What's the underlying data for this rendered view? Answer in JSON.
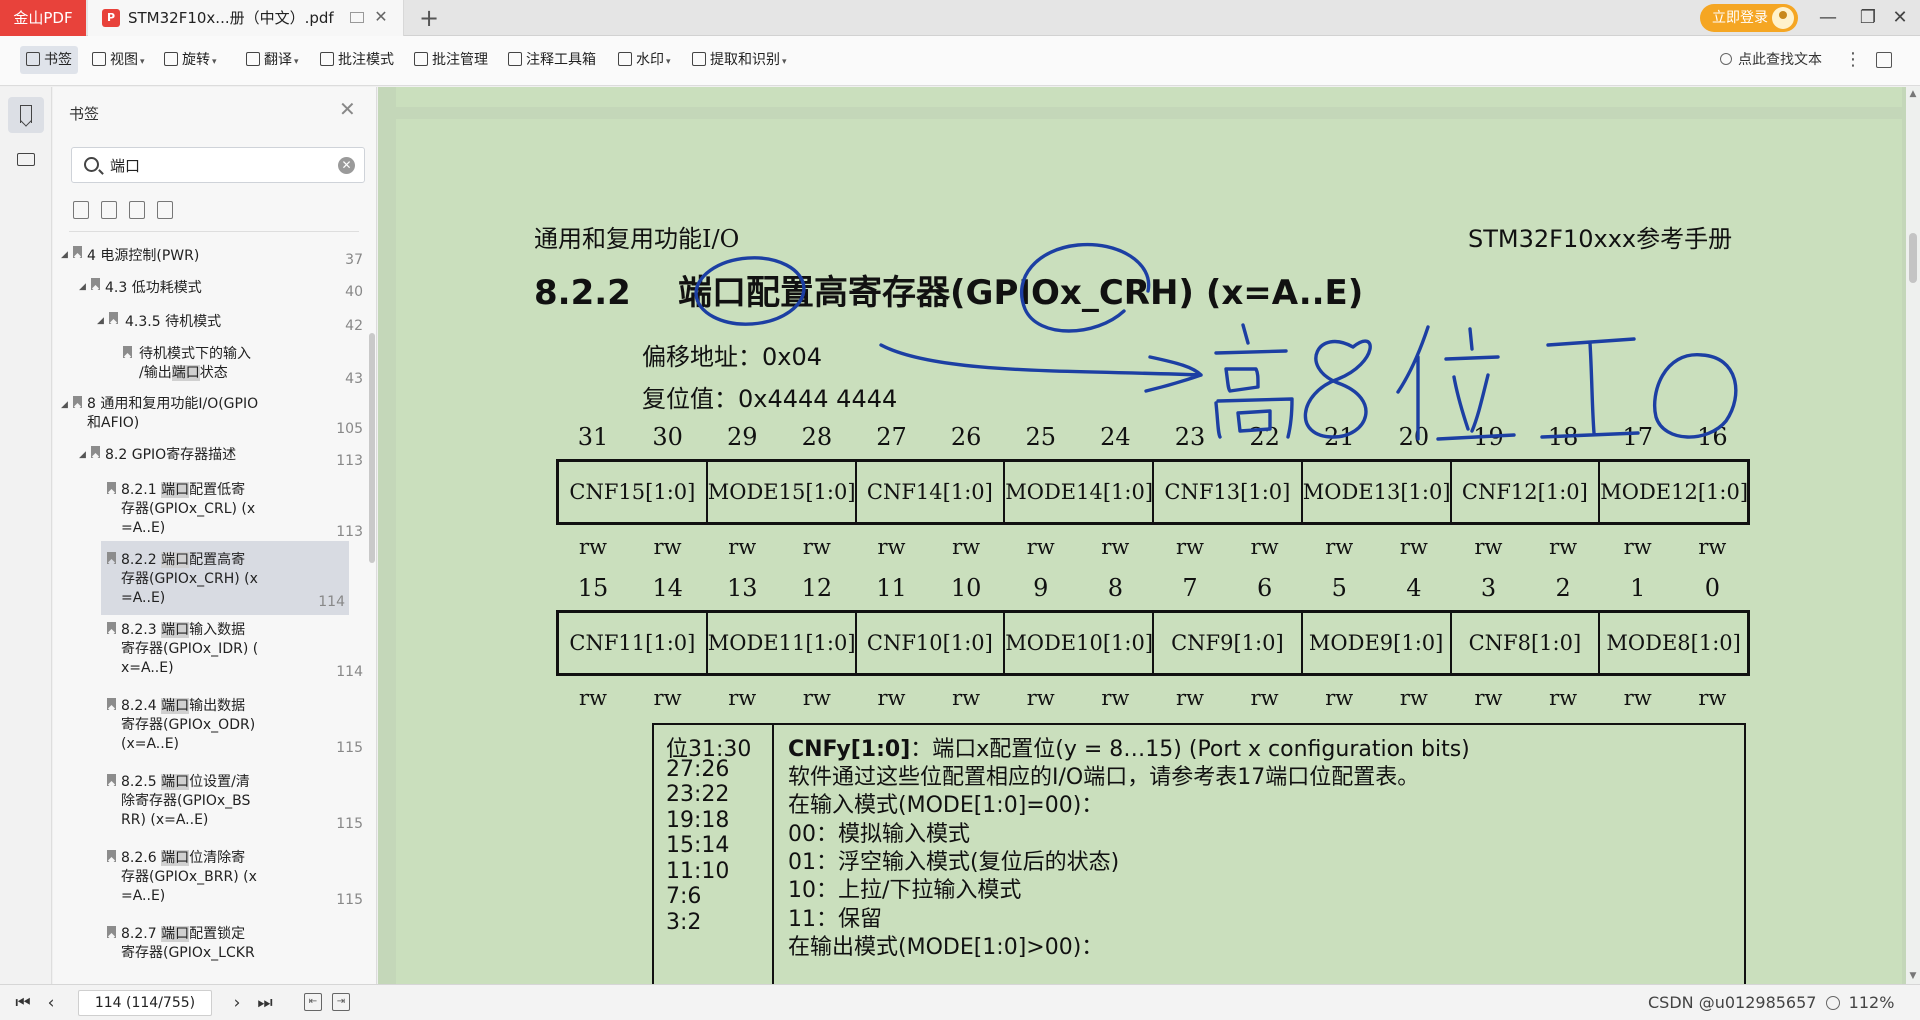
{
  "titlebar": {
    "app_name": "金山PDF",
    "doc_tab_title": "STM32F10x...册（中文）.pdf",
    "new_tab": "+",
    "login_label": "立即登录",
    "minimize": "—",
    "restore": "❐",
    "close": "✕",
    "accent_color": "#e8423b",
    "login_color": "#f5a623"
  },
  "toolbar": {
    "bookmark": "书签",
    "view": "视图",
    "rotate": "旋转",
    "translate": "翻译",
    "annotate_mode": "批注模式",
    "annotate_manage": "批注管理",
    "annotate_toolbox": "注释工具箱",
    "watermark": "水印",
    "extract_ocr": "提取和识别",
    "search_doc": "点此查找文本"
  },
  "sidebar": {
    "title": "书签",
    "search_value": "端口",
    "items": [
      {
        "caret": "◢",
        "text": "4 电源控制(PWR)",
        "page": "37"
      },
      {
        "caret": "◢",
        "text": "4.3 低功耗模式",
        "page": "40"
      },
      {
        "caret": "◢",
        "text": "4.3.5 待机模式",
        "page": "42"
      },
      {
        "line1": "待机模式下的输入",
        "line2_pre": "/输出",
        "line2_hl": "端口",
        "line2_post": "状态",
        "page": "43"
      },
      {
        "caret": "◢",
        "line1": "8 通用和复用功能I/O(GPIO",
        "line2": "和AFIO)",
        "page": "105"
      },
      {
        "caret": "◢",
        "text": "8.2 GPIO寄存器描述",
        "page": "113"
      },
      {
        "pre": "8.2.1 ",
        "hl": "端口",
        "post": "配置低寄",
        "line2": "存器(GPIOx_CRL) (x",
        "line3": "=A..E)",
        "page": "113"
      },
      {
        "pre": "8.2.2 ",
        "hl": "端口",
        "post": "配置高寄",
        "line2": "存器(GPIOx_CRH) (x",
        "line3": "=A..E)",
        "page": "114"
      },
      {
        "pre": "8.2.3 ",
        "hl": "端口",
        "post": "输入数据",
        "line2": "寄存器(GPIOx_IDR) (",
        "line3": "x=A..E)",
        "page": "114"
      },
      {
        "pre": "8.2.4 ",
        "hl": "端口",
        "post": "输出数据",
        "line2": "寄存器(GPIOx_ODR)",
        "line3": "(x=A..E)",
        "page": "115"
      },
      {
        "pre": "8.2.5 ",
        "hl": "端口",
        "post": "位设置/清",
        "line2": "除寄存器(GPIOx_BS",
        "line3": "RR) (x=A..E)",
        "page": "115"
      },
      {
        "pre": "8.2.6 ",
        "hl": "端口",
        "post": "位清除寄",
        "line2": "存器(GPIOx_BRR) (x",
        "line3": "=A..E)",
        "page": "115"
      },
      {
        "pre": "8.2.7 ",
        "hl": "端口",
        "post": "配置锁定",
        "line2": "寄存器(GPIOx_LCKR"
      }
    ]
  },
  "document": {
    "header_left": "通用和复用功能I/O",
    "header_right": "STM32F10xxx参考手册",
    "section_number": "8.2.2",
    "section_title": "端口配置高寄存器(GPIOx_CRH) (x=A..E)",
    "offset_line": "偏移地址：0x04",
    "reset_line": "复位值：0x4444 4444",
    "bits_high": [
      "31",
      "30",
      "29",
      "28",
      "27",
      "26",
      "25",
      "24",
      "23",
      "22",
      "21",
      "20",
      "19",
      "18",
      "17",
      "16"
    ],
    "fields_high": [
      "CNF15[1:0]",
      "MODE15[1:0]",
      "CNF14[1:0]",
      "MODE14[1:0]",
      "CNF13[1:0]",
      "MODE13[1:0]",
      "CNF12[1:0]",
      "MODE12[1:0]"
    ],
    "bits_low": [
      "15",
      "14",
      "13",
      "12",
      "11",
      "10",
      "9",
      "8",
      "7",
      "6",
      "5",
      "4",
      "3",
      "2",
      "1",
      "0"
    ],
    "fields_low": [
      "CNF11[1:0]",
      "MODE11[1:0]",
      "CNF10[1:0]",
      "MODE10[1:0]",
      "CNF9[1:0]",
      "MODE9[1:0]",
      "CNF8[1:0]",
      "MODE8[1:0]"
    ],
    "access": "rw",
    "desc_bits": [
      "位31:30",
      "27:26",
      "23:22",
      "19:18",
      "15:14",
      "11:10",
      "7:6",
      "3:2"
    ],
    "desc_head_bold": "CNFy[1:0]",
    "desc_head_rest": "：端口x配置位(y = 8…15) (Port x configuration bits)",
    "desc_lines": [
      "软件通过这些位配置相应的I/O端口，请参考表17端口位配置表。",
      "在输入模式(MODE[1:0]=00)：",
      "00：模拟输入模式",
      "01：浮空输入模式(复位后的状态)",
      "10：上拉/下拉输入模式",
      "11：保留",
      "在输出模式(MODE[1:0]>00)："
    ],
    "page_bg": "#cadfbd",
    "ink_color": "#1c3fa3"
  },
  "statusbar": {
    "page_indicator": "114 (114/755)",
    "watermark_text": "CSDN @u012985657",
    "zoom": "112%"
  }
}
